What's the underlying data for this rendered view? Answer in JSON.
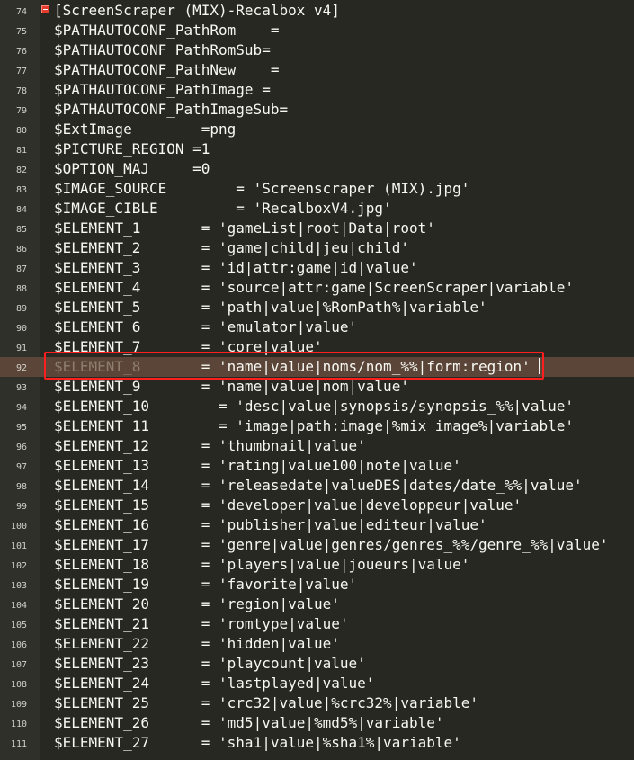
{
  "editor": {
    "section_header": "[ScreenScraper (MIX)-Recalbox v4]",
    "lines": [
      {
        "num": "74",
        "key": "[ScreenScraper (MIX)-Recalbox v4]",
        "pad": "",
        "value": ""
      },
      {
        "num": "75",
        "key": "$PATHAUTOCONF_PathRom",
        "pad": "    ",
        "value": "="
      },
      {
        "num": "76",
        "key": "$PATHAUTOCONF_PathRomSub",
        "pad": "",
        "value": "="
      },
      {
        "num": "77",
        "key": "$PATHAUTOCONF_PathNew",
        "pad": "    ",
        "value": "="
      },
      {
        "num": "78",
        "key": "$PATHAUTOCONF_PathImage",
        "pad": " ",
        "value": "="
      },
      {
        "num": "79",
        "key": "$PATHAUTOCONF_PathImageSub",
        "pad": "",
        "value": "="
      },
      {
        "num": "80",
        "key": "$ExtImage",
        "pad": "        ",
        "value": "=png"
      },
      {
        "num": "81",
        "key": "$PICTURE_REGION",
        "pad": " ",
        "value": "=1"
      },
      {
        "num": "82",
        "key": "$OPTION_MAJ",
        "pad": "     ",
        "value": "=0"
      },
      {
        "num": "83",
        "key": "$IMAGE_SOURCE",
        "pad": "        ",
        "value": "= 'Screenscraper (MIX).jpg'"
      },
      {
        "num": "84",
        "key": "$IMAGE_CIBLE",
        "pad": "         ",
        "value": "= 'RecalboxV4.jpg'"
      },
      {
        "num": "85",
        "key": "$ELEMENT_1",
        "pad": "       ",
        "value": "= 'gameList|root|Data|root'"
      },
      {
        "num": "86",
        "key": "$ELEMENT_2",
        "pad": "       ",
        "value": "= 'game|child|jeu|child'"
      },
      {
        "num": "87",
        "key": "$ELEMENT_3",
        "pad": "       ",
        "value": "= 'id|attr:game|id|value'"
      },
      {
        "num": "88",
        "key": "$ELEMENT_4",
        "pad": "       ",
        "value": "= 'source|attr:game|ScreenScraper|variable'"
      },
      {
        "num": "89",
        "key": "$ELEMENT_5",
        "pad": "       ",
        "value": "= 'path|value|%RomPath%|variable'"
      },
      {
        "num": "90",
        "key": "$ELEMENT_6",
        "pad": "       ",
        "value": "= 'emulator|value'"
      },
      {
        "num": "91",
        "key": "$ELEMENT_7",
        "pad": "       ",
        "value": "= 'core|value'"
      },
      {
        "num": "92",
        "key": "$ELEMENT_8",
        "pad": "       ",
        "value": "= 'name|value|noms/nom_%%|form:region'"
      },
      {
        "num": "93",
        "key": "$ELEMENT_9",
        "pad": "       ",
        "value": "= 'name|value|nom|value'"
      },
      {
        "num": "94",
        "key": "$ELEMENT_10",
        "pad": "        ",
        "value": "= 'desc|value|synopsis/synopsis_%%|value'"
      },
      {
        "num": "95",
        "key": "$ELEMENT_11",
        "pad": "        ",
        "value": "= 'image|path:image|%mix_image%|variable'"
      },
      {
        "num": "96",
        "key": "$ELEMENT_12",
        "pad": "      ",
        "value": "= 'thumbnail|value'"
      },
      {
        "num": "97",
        "key": "$ELEMENT_13",
        "pad": "      ",
        "value": "= 'rating|value100|note|value'"
      },
      {
        "num": "98",
        "key": "$ELEMENT_14",
        "pad": "      ",
        "value": "= 'releasedate|valueDES|dates/date_%%|value'"
      },
      {
        "num": "99",
        "key": "$ELEMENT_15",
        "pad": "      ",
        "value": "= 'developer|value|developpeur|value'"
      },
      {
        "num": "100",
        "key": "$ELEMENT_16",
        "pad": "      ",
        "value": "= 'publisher|value|editeur|value'"
      },
      {
        "num": "101",
        "key": "$ELEMENT_17",
        "pad": "      ",
        "value": "= 'genre|value|genres/genres_%%/genre_%%|value'"
      },
      {
        "num": "102",
        "key": "$ELEMENT_18",
        "pad": "      ",
        "value": "= 'players|value|joueurs|value'"
      },
      {
        "num": "103",
        "key": "$ELEMENT_19",
        "pad": "      ",
        "value": "= 'favorite|value'"
      },
      {
        "num": "104",
        "key": "$ELEMENT_20",
        "pad": "      ",
        "value": "= 'region|value'"
      },
      {
        "num": "105",
        "key": "$ELEMENT_21",
        "pad": "      ",
        "value": "= 'romtype|value'"
      },
      {
        "num": "106",
        "key": "$ELEMENT_22",
        "pad": "      ",
        "value": "= 'hidden|value'"
      },
      {
        "num": "107",
        "key": "$ELEMENT_23",
        "pad": "      ",
        "value": "= 'playcount|value'"
      },
      {
        "num": "108",
        "key": "$ELEMENT_24",
        "pad": "      ",
        "value": "= 'lastplayed|value'"
      },
      {
        "num": "109",
        "key": "$ELEMENT_25",
        "pad": "      ",
        "value": "= 'crc32|value|%crc32%|variable'"
      },
      {
        "num": "110",
        "key": "$ELEMENT_26",
        "pad": "      ",
        "value": "= 'md5|value|%md5%|variable'"
      },
      {
        "num": "111",
        "key": "$ELEMENT_27",
        "pad": "      ",
        "value": "= 'sha1|value|%sha1%|variable'"
      }
    ]
  },
  "colors": {
    "background": "#272822",
    "text": "#f8f8f2",
    "section_header": "#fd971f",
    "highlight_line": "#5a4538",
    "selection_box": "#ff1e1e",
    "fold_marker": "#e33b2e"
  }
}
